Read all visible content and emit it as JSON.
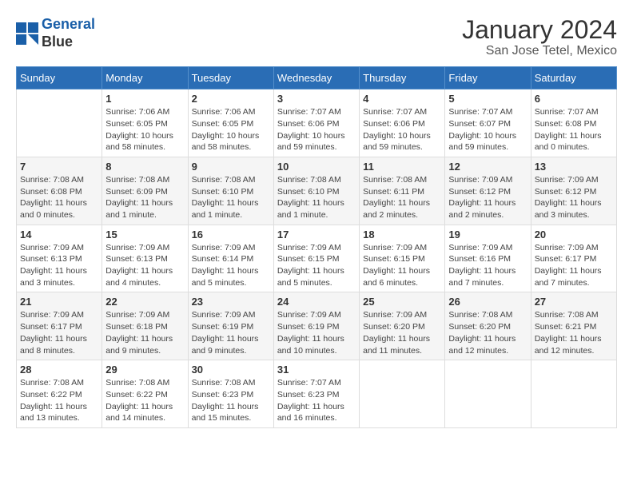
{
  "header": {
    "logo_line1": "General",
    "logo_line2": "Blue",
    "title": "January 2024",
    "subtitle": "San Jose Tetel, Mexico"
  },
  "columns": [
    "Sunday",
    "Monday",
    "Tuesday",
    "Wednesday",
    "Thursday",
    "Friday",
    "Saturday"
  ],
  "weeks": [
    [
      {
        "day": "",
        "info": ""
      },
      {
        "day": "1",
        "info": "Sunrise: 7:06 AM\nSunset: 6:05 PM\nDaylight: 10 hours\nand 58 minutes."
      },
      {
        "day": "2",
        "info": "Sunrise: 7:06 AM\nSunset: 6:05 PM\nDaylight: 10 hours\nand 58 minutes."
      },
      {
        "day": "3",
        "info": "Sunrise: 7:07 AM\nSunset: 6:06 PM\nDaylight: 10 hours\nand 59 minutes."
      },
      {
        "day": "4",
        "info": "Sunrise: 7:07 AM\nSunset: 6:06 PM\nDaylight: 10 hours\nand 59 minutes."
      },
      {
        "day": "5",
        "info": "Sunrise: 7:07 AM\nSunset: 6:07 PM\nDaylight: 10 hours\nand 59 minutes."
      },
      {
        "day": "6",
        "info": "Sunrise: 7:07 AM\nSunset: 6:08 PM\nDaylight: 11 hours\nand 0 minutes."
      }
    ],
    [
      {
        "day": "7",
        "info": "Sunrise: 7:08 AM\nSunset: 6:08 PM\nDaylight: 11 hours\nand 0 minutes."
      },
      {
        "day": "8",
        "info": "Sunrise: 7:08 AM\nSunset: 6:09 PM\nDaylight: 11 hours\nand 1 minute."
      },
      {
        "day": "9",
        "info": "Sunrise: 7:08 AM\nSunset: 6:10 PM\nDaylight: 11 hours\nand 1 minute."
      },
      {
        "day": "10",
        "info": "Sunrise: 7:08 AM\nSunset: 6:10 PM\nDaylight: 11 hours\nand 1 minute."
      },
      {
        "day": "11",
        "info": "Sunrise: 7:08 AM\nSunset: 6:11 PM\nDaylight: 11 hours\nand 2 minutes."
      },
      {
        "day": "12",
        "info": "Sunrise: 7:09 AM\nSunset: 6:12 PM\nDaylight: 11 hours\nand 2 minutes."
      },
      {
        "day": "13",
        "info": "Sunrise: 7:09 AM\nSunset: 6:12 PM\nDaylight: 11 hours\nand 3 minutes."
      }
    ],
    [
      {
        "day": "14",
        "info": "Sunrise: 7:09 AM\nSunset: 6:13 PM\nDaylight: 11 hours\nand 3 minutes."
      },
      {
        "day": "15",
        "info": "Sunrise: 7:09 AM\nSunset: 6:13 PM\nDaylight: 11 hours\nand 4 minutes."
      },
      {
        "day": "16",
        "info": "Sunrise: 7:09 AM\nSunset: 6:14 PM\nDaylight: 11 hours\nand 5 minutes."
      },
      {
        "day": "17",
        "info": "Sunrise: 7:09 AM\nSunset: 6:15 PM\nDaylight: 11 hours\nand 5 minutes."
      },
      {
        "day": "18",
        "info": "Sunrise: 7:09 AM\nSunset: 6:15 PM\nDaylight: 11 hours\nand 6 minutes."
      },
      {
        "day": "19",
        "info": "Sunrise: 7:09 AM\nSunset: 6:16 PM\nDaylight: 11 hours\nand 7 minutes."
      },
      {
        "day": "20",
        "info": "Sunrise: 7:09 AM\nSunset: 6:17 PM\nDaylight: 11 hours\nand 7 minutes."
      }
    ],
    [
      {
        "day": "21",
        "info": "Sunrise: 7:09 AM\nSunset: 6:17 PM\nDaylight: 11 hours\nand 8 minutes."
      },
      {
        "day": "22",
        "info": "Sunrise: 7:09 AM\nSunset: 6:18 PM\nDaylight: 11 hours\nand 9 minutes."
      },
      {
        "day": "23",
        "info": "Sunrise: 7:09 AM\nSunset: 6:19 PM\nDaylight: 11 hours\nand 9 minutes."
      },
      {
        "day": "24",
        "info": "Sunrise: 7:09 AM\nSunset: 6:19 PM\nDaylight: 11 hours\nand 10 minutes."
      },
      {
        "day": "25",
        "info": "Sunrise: 7:09 AM\nSunset: 6:20 PM\nDaylight: 11 hours\nand 11 minutes."
      },
      {
        "day": "26",
        "info": "Sunrise: 7:08 AM\nSunset: 6:20 PM\nDaylight: 11 hours\nand 12 minutes."
      },
      {
        "day": "27",
        "info": "Sunrise: 7:08 AM\nSunset: 6:21 PM\nDaylight: 11 hours\nand 12 minutes."
      }
    ],
    [
      {
        "day": "28",
        "info": "Sunrise: 7:08 AM\nSunset: 6:22 PM\nDaylight: 11 hours\nand 13 minutes."
      },
      {
        "day": "29",
        "info": "Sunrise: 7:08 AM\nSunset: 6:22 PM\nDaylight: 11 hours\nand 14 minutes."
      },
      {
        "day": "30",
        "info": "Sunrise: 7:08 AM\nSunset: 6:23 PM\nDaylight: 11 hours\nand 15 minutes."
      },
      {
        "day": "31",
        "info": "Sunrise: 7:07 AM\nSunset: 6:23 PM\nDaylight: 11 hours\nand 16 minutes."
      },
      {
        "day": "",
        "info": ""
      },
      {
        "day": "",
        "info": ""
      },
      {
        "day": "",
        "info": ""
      }
    ]
  ]
}
